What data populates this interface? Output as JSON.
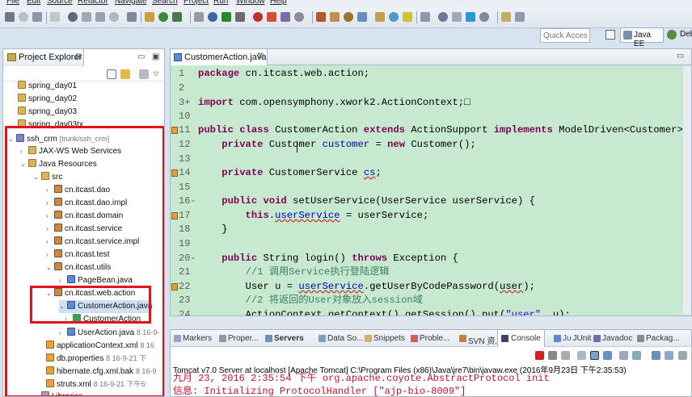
{
  "menu": [
    "File",
    "Edit",
    "Source",
    "Refactor",
    "Navigate",
    "Search",
    "Project",
    "Run",
    "Window",
    "Help"
  ],
  "toolbar": {
    "quick_access_placeholder": "Quick Access",
    "perspective_javaee": "Java EE",
    "perspective_debug": "Deb"
  },
  "explorer": {
    "title": "Project Explorer",
    "tree": [
      {
        "label": "spring_day01",
        "icon": "folder-icon",
        "depth": 1
      },
      {
        "label": "spring_day02",
        "icon": "folder-icon",
        "depth": 1
      },
      {
        "label": "spring_day03",
        "icon": "folder-icon",
        "depth": 1
      },
      {
        "label": "spring_day03tx",
        "icon": "folder-icon",
        "depth": 1
      },
      {
        "label": "ssh_crm",
        "decoration": "[trunk/ssh_crm]",
        "icon": "project-icon",
        "depth": 0,
        "expanded": true
      },
      {
        "label": "JAX-WS Web Services",
        "icon": "folder-icon",
        "depth": 1
      },
      {
        "label": "Java Resources",
        "icon": "folder-icon",
        "depth": 1,
        "expanded": true
      },
      {
        "label": "src",
        "icon": "folder-icon",
        "depth": 2,
        "expanded": true
      },
      {
        "label": "cn.itcast.dao",
        "icon": "package-icon",
        "depth": 3
      },
      {
        "label": "cn.itcast.dao.impl",
        "icon": "package-icon",
        "depth": 3
      },
      {
        "label": "cn.itcast.domain",
        "icon": "package-icon",
        "depth": 3
      },
      {
        "label": "cn.itcast.service",
        "icon": "package-icon",
        "depth": 3
      },
      {
        "label": "cn.itcast.service.impl",
        "icon": "package-icon",
        "depth": 3
      },
      {
        "label": "cn.itcast.test",
        "icon": "package-icon",
        "depth": 3
      },
      {
        "label": "cn.itcast.utils",
        "icon": "package-icon",
        "depth": 3,
        "expanded": true
      },
      {
        "label": "PageBean.java",
        "icon": "java-file-icon",
        "depth": 4
      },
      {
        "label": "cn.itcast.web.action",
        "icon": "package-icon",
        "depth": 3,
        "expanded": true
      },
      {
        "label": "CustomerAction.java",
        "icon": "java-file-icon",
        "depth": 4,
        "expanded": true,
        "selected": true
      },
      {
        "label": "CustomerAction",
        "icon": "class-icon",
        "depth": 5
      },
      {
        "label": "UserAction.java",
        "decoration": "8  16-9-",
        "icon": "java-file-icon",
        "depth": 4
      },
      {
        "label": "applicationContext.xml",
        "decoration": "8  16",
        "icon": "xml-file-icon",
        "depth": 3
      },
      {
        "label": "db.properties",
        "decoration": "8  16-9-21 下",
        "icon": "xml-file-icon",
        "depth": 3
      },
      {
        "label": "hibernate.cfg.xml.bak",
        "decoration": "8  16-9",
        "icon": "xml-file-icon",
        "depth": 3
      },
      {
        "label": "struts.xml",
        "decoration": "8  16-9-21 下午5:",
        "icon": "xml-file-icon",
        "depth": 3
      },
      {
        "label": "Libraries",
        "icon": "library-icon",
        "depth": 2
      }
    ]
  },
  "editor": {
    "tab_label": "CustomerAction.java",
    "lines": [
      {
        "n": "1",
        "segs": [
          [
            "kw",
            "package"
          ],
          [
            "",
            " cn.itcast.web.action;"
          ]
        ]
      },
      {
        "n": "2",
        "segs": []
      },
      {
        "n": "3+",
        "segs": [
          [
            "kw",
            "import"
          ],
          [
            "",
            " com.opensymphony.xwork2.ActionContext;□"
          ]
        ]
      },
      {
        "n": "10",
        "segs": []
      },
      {
        "n": "11",
        "marker": true,
        "segs": [
          [
            "kw",
            "public class"
          ],
          [
            "",
            " CustomerAction "
          ],
          [
            "kw",
            "extends"
          ],
          [
            "",
            " ActionSupport "
          ],
          [
            "kw",
            "implements"
          ],
          [
            "",
            " ModelDriven<Customer> {"
          ]
        ]
      },
      {
        "n": "12",
        "segs": [
          [
            "",
            "    "
          ],
          [
            "kw",
            "private"
          ],
          [
            "",
            " Customer "
          ],
          [
            "fld",
            "customer"
          ],
          [
            "",
            " = "
          ],
          [
            "kw",
            "new"
          ],
          [
            "",
            " Customer();"
          ]
        ]
      },
      {
        "n": "13",
        "segs": []
      },
      {
        "n": "14",
        "marker": true,
        "segs": [
          [
            "",
            "    "
          ],
          [
            "kw",
            "private"
          ],
          [
            "",
            " CustomerService "
          ],
          [
            "fld ul",
            "cs"
          ],
          [
            "",
            ";"
          ]
        ]
      },
      {
        "n": "15",
        "segs": []
      },
      {
        "n": "16-",
        "segs": [
          [
            "",
            "    "
          ],
          [
            "kw",
            "public void"
          ],
          [
            "",
            " setUserService(UserService userService) {"
          ]
        ]
      },
      {
        "n": "17",
        "marker": true,
        "segs": [
          [
            "",
            "        "
          ],
          [
            "kw",
            "this"
          ],
          [
            "",
            "."
          ],
          [
            "fld ul",
            "userService"
          ],
          [
            "",
            " = userService;"
          ]
        ]
      },
      {
        "n": "18",
        "segs": [
          [
            "",
            "    }"
          ]
        ]
      },
      {
        "n": "19",
        "segs": []
      },
      {
        "n": "20-",
        "segs": [
          [
            "",
            "    "
          ],
          [
            "kw",
            "public"
          ],
          [
            "",
            " String login() "
          ],
          [
            "kw",
            "throws"
          ],
          [
            "",
            " Exception {"
          ]
        ]
      },
      {
        "n": "21",
        "segs": [
          [
            "",
            "        "
          ],
          [
            "cm",
            "//1 调用Service执行登陆逻辑"
          ]
        ]
      },
      {
        "n": "22",
        "marker": true,
        "segs": [
          [
            "",
            "        User u = "
          ],
          [
            "fld ul",
            "userService"
          ],
          [
            "",
            ".getUserByCodePassword("
          ],
          [
            "ul",
            "user"
          ],
          [
            "",
            ");"
          ]
        ]
      },
      {
        "n": "23",
        "segs": [
          [
            "",
            "        "
          ],
          [
            "cm",
            "//2 将返回的User对象放入session域"
          ]
        ]
      },
      {
        "n": "24",
        "segs": [
          [
            "",
            "        ActionContext.getContext().getSession().put("
          ],
          [
            "str",
            "\"user\""
          ],
          [
            "",
            ", u);"
          ]
        ]
      }
    ]
  },
  "console": {
    "tabs": [
      {
        "label": "Markers",
        "color": "#a0a0c0"
      },
      {
        "label": "Proper...",
        "color": "#8899aa"
      },
      {
        "label": "Servers",
        "color": "#6d8fb8",
        "bold": true
      },
      {
        "label": "Data So...",
        "color": "#7ea0c0"
      },
      {
        "label": "Snippets",
        "color": "#d0b070"
      },
      {
        "label": "Proble...",
        "color": "#d06060"
      },
      {
        "label": "SVN 资...",
        "color": "#c08040"
      },
      {
        "label": "Console",
        "color": "#404060",
        "active": true
      },
      {
        "label": "JUnit",
        "color": "#5a8ad0",
        "prefix": "Ju"
      },
      {
        "label": "Javadoc",
        "color": "#7070b0"
      },
      {
        "label": "Packag...",
        "color": "#8a8a8a"
      }
    ],
    "description": "Tomcat v7.0 Server at localhost [Apache Tomcat] C:\\Program Files (x86)\\Java\\jre7\\bin\\javaw.exe (2016年9月23日 下午2:35:53)",
    "output": [
      "九月 23, 2016 2:35:54 下午 org.apache.coyote.AbstractProtocol init",
      "信息: Initializing ProtocolHandler [\"ajp-bio-8009\"]"
    ]
  }
}
